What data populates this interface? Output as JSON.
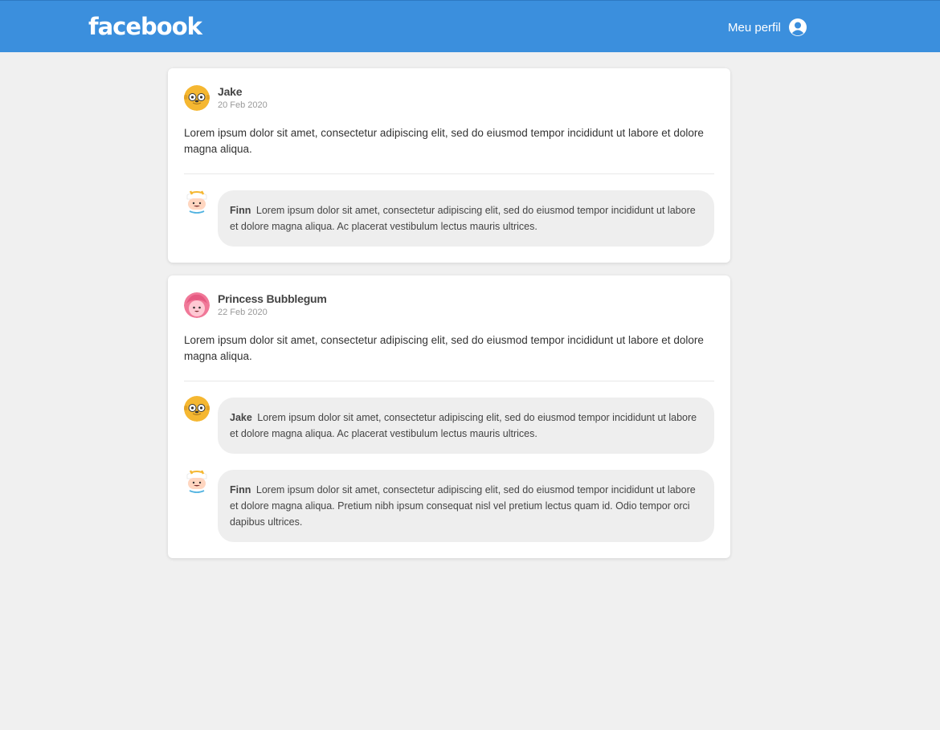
{
  "header": {
    "logo": "facebook",
    "profile_label": "Meu perfil",
    "profile_icon": "user-circle-icon",
    "bg_color": "#3b8fdd"
  },
  "posts": [
    {
      "author": "Jake",
      "date": "20 Feb 2020",
      "avatar": "jake-avatar-icon",
      "text": "Lorem ipsum dolor sit amet, consectetur adipiscing elit, sed do eiusmod tempor incididunt ut labore et dolore magna aliqua.",
      "comments": [
        {
          "author": "Finn",
          "avatar": "finn-avatar-icon",
          "text": "Lorem ipsum dolor sit amet, consectetur adipiscing elit, sed do eiusmod tempor incididunt ut labore et dolore magna aliqua. Ac placerat vestibulum lectus mauris ultrices."
        }
      ]
    },
    {
      "author": "Princess Bubblegum",
      "date": "22 Feb 2020",
      "avatar": "bubblegum-avatar-icon",
      "text": "Lorem ipsum dolor sit amet, consectetur adipiscing elit, sed do eiusmod tempor incididunt ut labore et dolore magna aliqua.",
      "comments": [
        {
          "author": "Jake",
          "avatar": "jake-avatar-icon",
          "text": "Lorem ipsum dolor sit amet, consectetur adipiscing elit, sed do eiusmod tempor incididunt ut labore et dolore magna aliqua. Ac placerat vestibulum lectus mauris ultrices."
        },
        {
          "author": "Finn",
          "avatar": "finn-avatar-icon",
          "text": "Lorem ipsum dolor sit amet, consectetur adipiscing elit, sed do eiusmod tempor incididunt ut labore et dolore magna aliqua. Pretium nibh ipsum consequat nisl vel pretium lectus quam id. Odio tempor orci dapibus ultrices."
        }
      ]
    }
  ]
}
